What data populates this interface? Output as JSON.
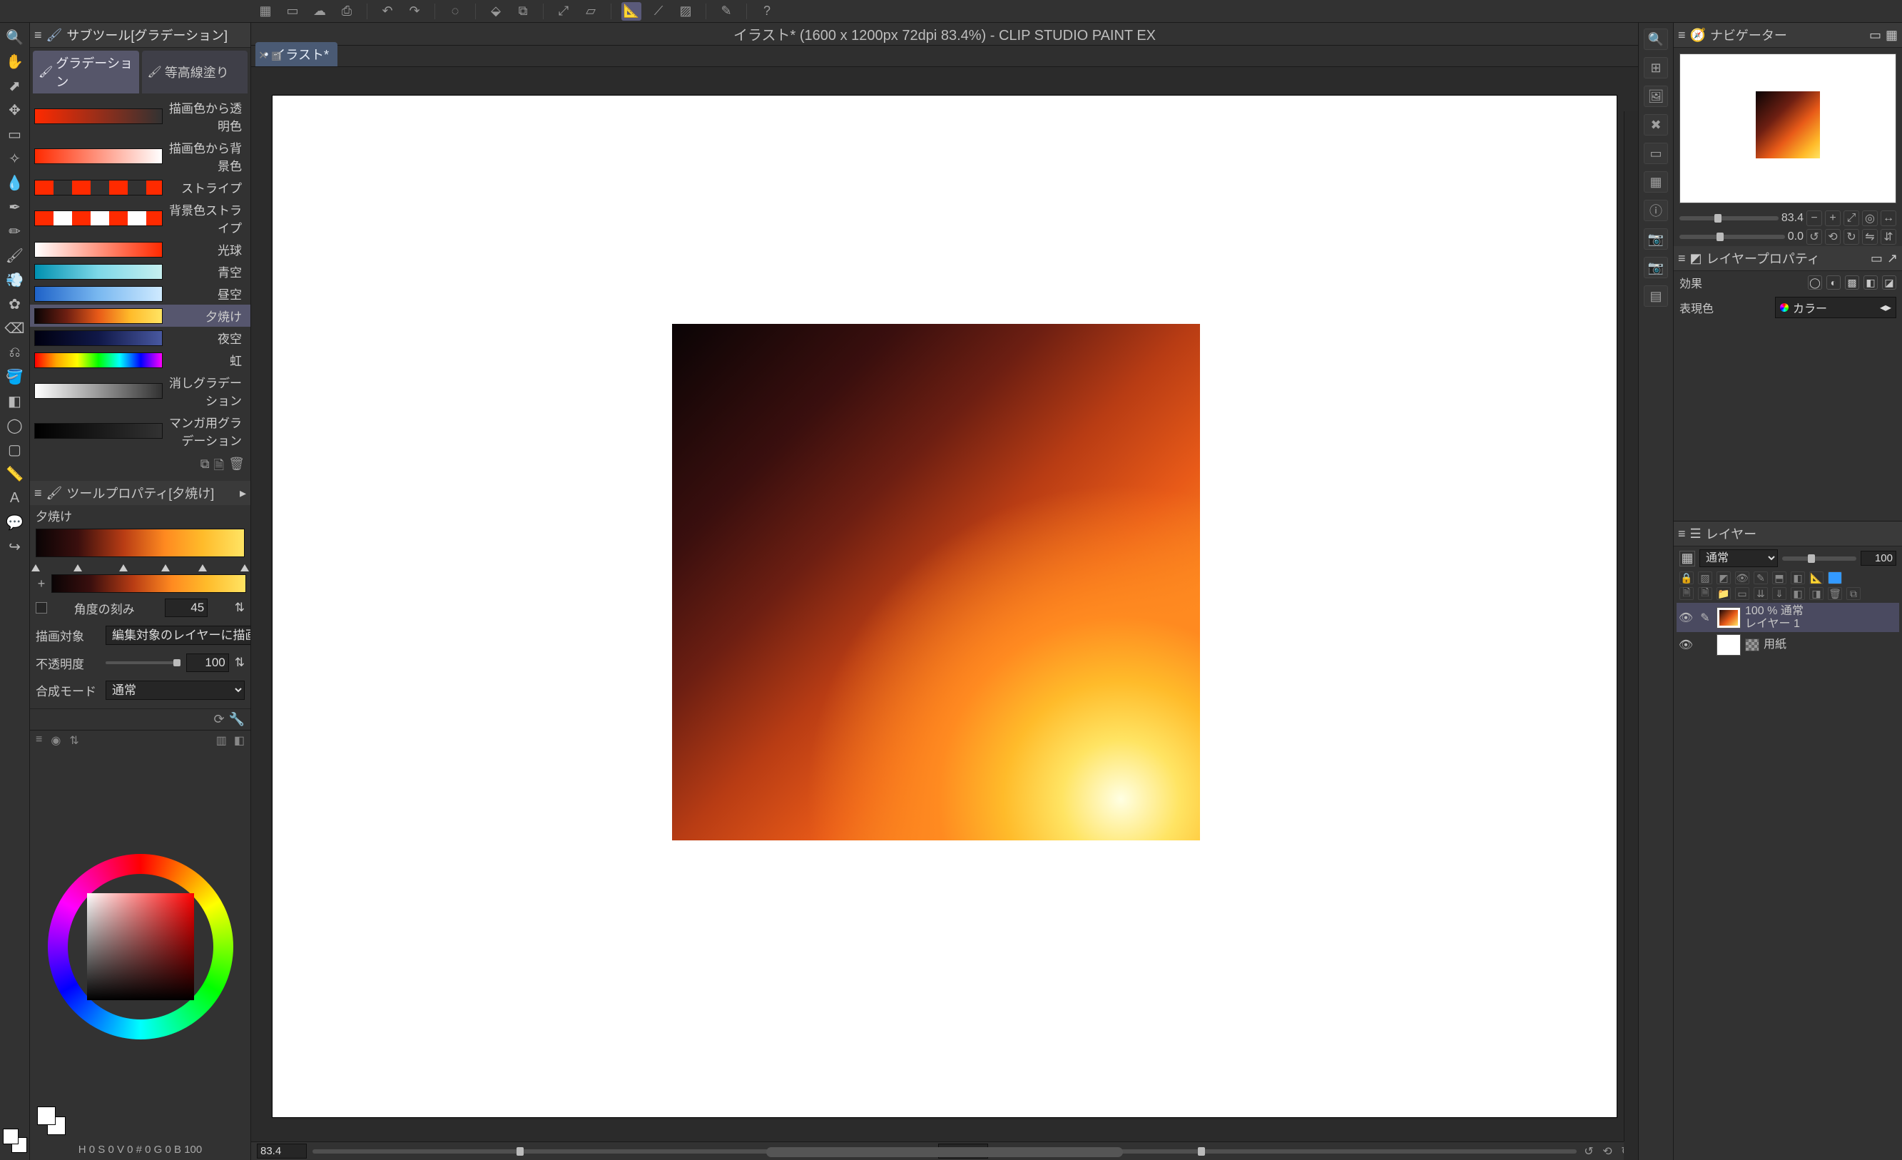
{
  "app": {
    "doc_title": "イラスト* (1600 x 1200px 72dpi 83.4%)  - CLIP STUDIO PAINT EX",
    "doc_tab": "イラスト*",
    "zoom": "83.4",
    "rotation": "0.0"
  },
  "subtool": {
    "panel_title": "サブツール[グラデーション]",
    "tabs": [
      {
        "label": "グラデーション",
        "active": true
      },
      {
        "label": "等高線塗り",
        "active": false
      }
    ],
    "presets": [
      {
        "name": "描画色から透明色",
        "grad": "linear-gradient(90deg, #ff2a00, rgba(255,42,0,0))",
        "selected": false
      },
      {
        "name": "描画色から背景色",
        "grad": "linear-gradient(90deg, #ff2a00, #ffffff)",
        "selected": false
      },
      {
        "name": "ストライプ",
        "grad": "repeating-linear-gradient(90deg,#ff2a00 0 26px, transparent 26px 52px)",
        "selected": false
      },
      {
        "name": "背景色ストライプ",
        "grad": "repeating-linear-gradient(90deg,#ff2a00 0 26px, #ffffff 26px 52px)",
        "selected": false
      },
      {
        "name": "光球",
        "grad": "linear-gradient(90deg,#ffffff,#ff2a00)",
        "selected": false
      },
      {
        "name": "青空",
        "grad": "linear-gradient(90deg,#0090b0,#7ed8e8,#c6efef)",
        "selected": false
      },
      {
        "name": "昼空",
        "grad": "linear-gradient(90deg,#1e62c8,#79b8f0,#cfeaff)",
        "selected": false
      },
      {
        "name": "夕焼け",
        "grad": "linear-gradient(90deg,#0a0405,#6e1f12,#e85a18,#ffbb2a,#ffe463)",
        "selected": true
      },
      {
        "name": "夜空",
        "grad": "linear-gradient(90deg,#000010,#101848,#4858a0)",
        "selected": false
      },
      {
        "name": "虹",
        "grad": "linear-gradient(90deg,red,orange,yellow,lime,cyan,blue,magenta)",
        "selected": false
      },
      {
        "name": "消しグラデーション",
        "grad": "linear-gradient(90deg,#ffffff,rgba(255,255,255,0))",
        "selected": false
      },
      {
        "name": "マンガ用グラデーション",
        "grad": "linear-gradient(90deg,#000000,rgba(0,0,0,0))",
        "selected": false
      }
    ]
  },
  "toolprop": {
    "panel_title": "ツールプロパティ[夕焼け]",
    "preset_name": "夕焼け",
    "gradient": "linear-gradient(90deg,#0a0405 0%,#3a0f0e 20%,#b83c14 42%,#ff8a20 62%,#ffbb2a 80%,#ffe463 100%)",
    "stops_pct": [
      0,
      20,
      42,
      62,
      80,
      100
    ],
    "angle_step_label": "角度の刻み",
    "angle_step_checked": false,
    "angle_step_value": "45",
    "target_label": "描画対象",
    "target_value": "編集対象のレイヤーに描画",
    "opacity_label": "不透明度",
    "opacity_value": "100",
    "blend_label": "合成モード",
    "blend_value": "通常"
  },
  "colorwheel": {
    "hsv_labels": [
      "H",
      "S",
      "V"
    ],
    "readout": "H 0  S 0  V 0  #  0  G  0  B 100"
  },
  "navigator": {
    "title": "ナビゲーター",
    "zoom_value": "83.4",
    "rotation_value": "0.0"
  },
  "layerprop": {
    "title": "レイヤープロパティ",
    "effect_label": "効果",
    "surface_label": "表現色",
    "surface_value": "カラー"
  },
  "layers": {
    "title": "レイヤー",
    "blend_mode": "通常",
    "opacity": "100",
    "list": [
      {
        "eye": true,
        "pen": true,
        "thumb_class": "sunset",
        "line1": "100 % 通常",
        "line2": "レイヤー 1",
        "selected": true,
        "mask": false
      },
      {
        "eye": true,
        "pen": false,
        "thumb_class": "",
        "line1": "",
        "line2": "用紙",
        "selected": false,
        "mask": true
      }
    ]
  }
}
